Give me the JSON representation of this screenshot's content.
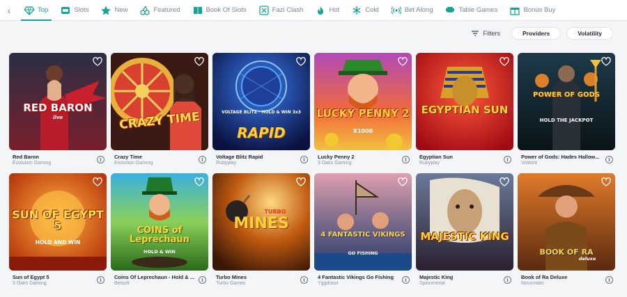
{
  "nav": {
    "tabs": [
      {
        "label": "Top",
        "icon": "diamond-icon",
        "active": true
      },
      {
        "label": "Slots",
        "icon": "slot-machine-icon"
      },
      {
        "label": "New",
        "icon": "star-icon"
      },
      {
        "label": "Featured",
        "icon": "cherries-icon"
      },
      {
        "label": "Book Of Slots",
        "icon": "book-icon"
      },
      {
        "label": "Fazi Clash",
        "icon": "clash-icon"
      },
      {
        "label": "Hot",
        "icon": "flame-icon"
      },
      {
        "label": "Cold",
        "icon": "snowflake-icon"
      },
      {
        "label": "Bet Along",
        "icon": "broadcast-icon"
      },
      {
        "label": "Table Games",
        "icon": "table-icon"
      },
      {
        "label": "Bonus Buy",
        "icon": "gift-icon"
      }
    ]
  },
  "filters": {
    "filters_label": "Filters",
    "providers_label": "Providers",
    "volatility_label": "Volatility"
  },
  "games": [
    {
      "name": "Red Baron",
      "provider": "Evolution Gaming",
      "logo": "RED BARON",
      "logo_sub": "live"
    },
    {
      "name": "Crazy Time",
      "provider": "Evolution Gaming",
      "logo": "CRAZY TIME",
      "logo_sub": ""
    },
    {
      "name": "Voltage Blitz Rapid",
      "provider": "Rubyplay",
      "logo": "RAPID",
      "logo_sub": "VOLTAGE BLITZ · HOLD & WIN 3x3"
    },
    {
      "name": "Lucky Penny 2",
      "provider": "3 Oaks Gaming",
      "logo": "LUCKY PENNY 2",
      "logo_sub": "X1000"
    },
    {
      "name": "Egyptian Sun",
      "provider": "Rubyplay",
      "logo": "EGYPTIAN SUN",
      "logo_sub": ""
    },
    {
      "name": "Power of Gods: Hades Hallow...",
      "provider": "Volitont",
      "logo": "POWER OF GODS",
      "logo_sub": "HOLD THE JACKPOT"
    },
    {
      "name": "Sun of Egypt 5",
      "provider": "3 Oaks Gaming",
      "logo": "SUN OF EGYPT 5",
      "logo_sub": "HOLD AND WIN"
    },
    {
      "name": "Coins Of Leprechaun - Hold & ...",
      "provider": "Betsoft",
      "logo": "COINS of Leprechaun",
      "logo_sub": "HOLD & WIN"
    },
    {
      "name": "Turbo Mines",
      "provider": "Turbo Games",
      "logo": "MINES",
      "logo_sub": "TURBO"
    },
    {
      "name": "4 Fantastic Vikings Go Fishing",
      "provider": "Yggdrasil",
      "logo": "4 FANTASTIC VIKINGS",
      "logo_sub": "GO FISHING"
    },
    {
      "name": "Majestic King",
      "provider": "Spinomenal",
      "logo": "MAJESTIC KING",
      "logo_sub": ""
    },
    {
      "name": "Book of Ra Deluxe",
      "provider": "Novomatic",
      "logo": "BOOK OF RA",
      "logo_sub": "deluxe"
    }
  ],
  "info_glyph": "i",
  "colors": {
    "accent": "#14a394",
    "text": "#1d2533",
    "muted": "#8a93a3"
  }
}
